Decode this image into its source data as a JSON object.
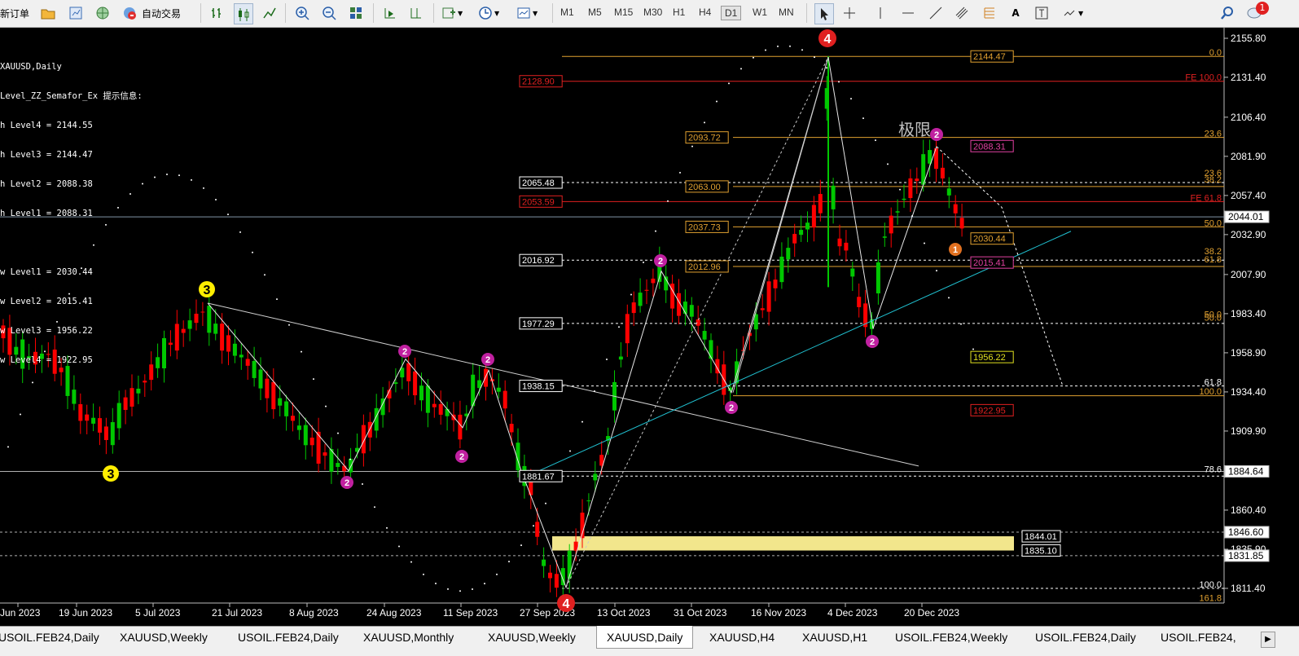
{
  "toolbar": {
    "new_order": "新订单",
    "auto_trading": "自动交易",
    "timeframes": [
      "M1",
      "M5",
      "M15",
      "M30",
      "H1",
      "H4",
      "D1",
      "W1",
      "MN"
    ],
    "active_timeframe": "D1",
    "notification_count": "1"
  },
  "chart": {
    "symbol_title": "XAUUSD,Daily",
    "indicator_header": "Level_ZZ_Semafor_Ex 提示信息:",
    "high_levels": [
      "h Level4 = 2144.55",
      "h Level3 = 2144.47",
      "h Level2 = 2088.38",
      "h Level1 = 2088.31"
    ],
    "low_levels": [
      "w Level1 = 2030.44",
      "w Level2 = 2015.41",
      "w Level3 = 1956.22",
      "w Level4 = 1922.95"
    ],
    "annotation": "极限",
    "price_axis": [
      "2155.80",
      "2131.40",
      "2106.40",
      "2081.90",
      "2057.40",
      "2032.90",
      "2007.90",
      "1983.40",
      "1958.90",
      "1934.40",
      "1909.90",
      "1884.60",
      "1860.40",
      "1835.90",
      "1811.40"
    ],
    "current_price": "2044.01",
    "hline_labels": [
      "1884.64",
      "1846.60",
      "1831.85"
    ],
    "box_labels": [
      "1844.01",
      "1835.10"
    ],
    "level_labels_left": [
      "2128.90",
      "2065.48",
      "2053.59",
      "2016.92",
      "1977.29",
      "1938.15",
      "1881.67"
    ],
    "level_labels_mid": [
      "2093.72",
      "2063.00",
      "2037.73",
      "2012.96"
    ],
    "level_labels_right": [
      "2144.47",
      "2088.31",
      "2030.44",
      "2015.41",
      "1956.22",
      "1922.95"
    ],
    "fib_labels": [
      "0.0",
      "FE 100.0",
      "23.6",
      "23.6",
      "38.2",
      "FE 61.8",
      "50.0",
      "38.2",
      "61.8",
      "50.0",
      "50.0",
      "61.8",
      "100.0",
      "78.6",
      "100.0",
      "161.8"
    ],
    "semafor_marks": [
      "3",
      "3",
      "2",
      "2",
      "2",
      "2",
      "2",
      "2",
      "2",
      "2",
      "1",
      "4",
      "4"
    ],
    "date_axis": [
      "Jun 2023",
      "19 Jun 2023",
      "5 Jul 2023",
      "21 Jul 2023",
      "8 Aug 2023",
      "24 Aug 2023",
      "11 Sep 2023",
      "27 Sep 2023",
      "13 Oct 2023",
      "31 Oct 2023",
      "16 Nov 2023",
      "4 Dec 2023",
      "20 Dec 2023"
    ],
    "colors": {
      "bull": "#00c800",
      "bear": "#ff0000",
      "fib": "#e0a030",
      "fe": "#e02020",
      "trend": "#20c0d0"
    }
  },
  "tabs": [
    "USOIL.FEB24,Daily",
    "XAUUSD,Weekly",
    "USOIL.FEB24,Daily",
    "XAUUSD,Monthly",
    "XAUUSD,Weekly",
    "XAUUSD,Daily",
    "XAUUSD,H4",
    "XAUUSD,H1",
    "USOIL.FEB24,Weekly",
    "USOIL.FEB24,Daily",
    "USOIL.FEB24,"
  ],
  "active_tab_index": 5
}
